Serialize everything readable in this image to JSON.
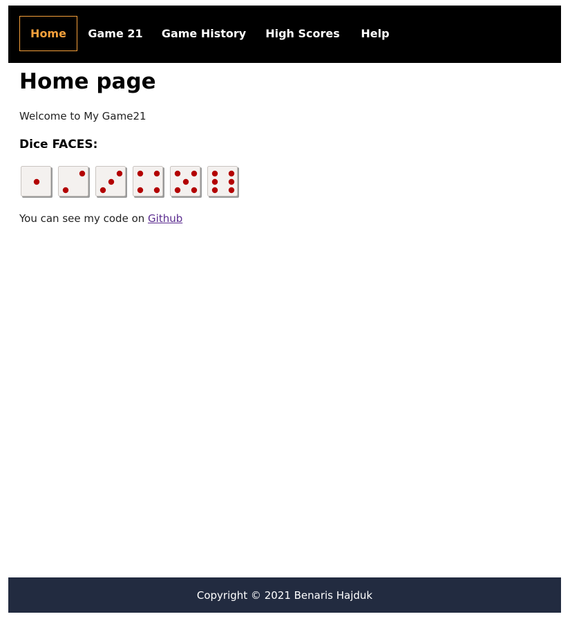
{
  "nav": {
    "items": [
      {
        "label": "Home",
        "active": true
      },
      {
        "label": "Game 21",
        "active": false
      },
      {
        "label": "Game History",
        "active": false
      },
      {
        "label": "High Scores",
        "active": false
      },
      {
        "label": "Help",
        "active": false
      }
    ],
    "active_color": "#f7a13b",
    "background": "#000000"
  },
  "main": {
    "title": "Home page",
    "welcome_text": "Welcome to My Game21",
    "dice_heading": "Dice FACES:",
    "dice_faces": [
      1,
      2,
      3,
      4,
      5,
      6
    ],
    "dice_pip_color": "#b30000",
    "code_text": "You can see my code on ",
    "code_link_label": "Github"
  },
  "footer": {
    "text": "Copyright © 2021 Benaris Hajduk",
    "background": "#222b40"
  }
}
